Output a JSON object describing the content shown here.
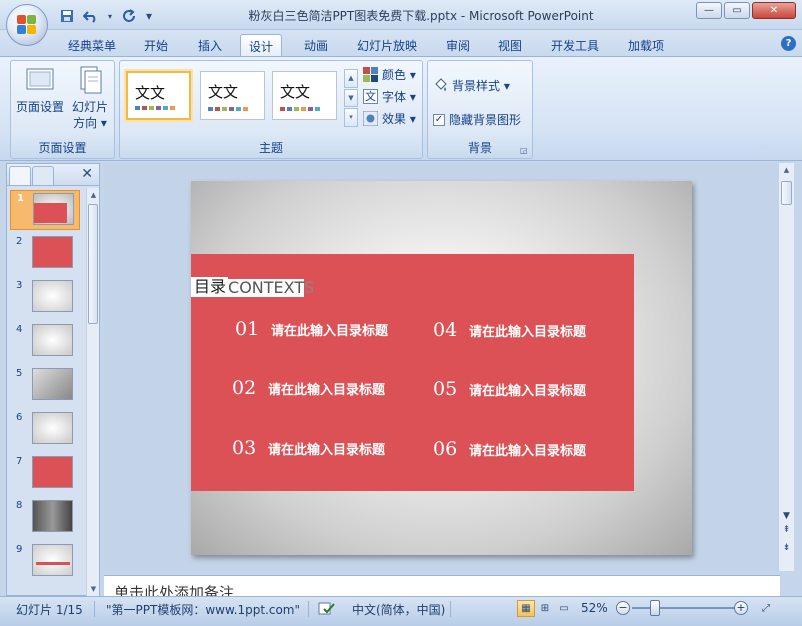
{
  "window": {
    "title": "粉灰白三色简洁PPT图表免费下载.pptx - Microsoft PowerPoint",
    "minimize": "—",
    "maximize": "▭",
    "close": "✕"
  },
  "qat": {
    "save_icon": "save-icon",
    "undo_icon": "undo-icon",
    "redo_icon": "redo-icon",
    "customize": "▾"
  },
  "tabs": [
    {
      "label": "经典菜单"
    },
    {
      "label": "开始"
    },
    {
      "label": "插入"
    },
    {
      "label": "设计",
      "active": true
    },
    {
      "label": "动画"
    },
    {
      "label": "幻灯片放映"
    },
    {
      "label": "审阅"
    },
    {
      "label": "视图"
    },
    {
      "label": "开发工具"
    },
    {
      "label": "加载项"
    }
  ],
  "ribbon": {
    "page_setup": {
      "label": "页面设置",
      "page_setup_btn": "页面设置",
      "orientation_btn_line1": "幻灯片",
      "orientation_btn_line2": "方向 ▾"
    },
    "themes": {
      "label": "主题",
      "thumb_text": "文文",
      "colors": "颜色 ▾",
      "fonts": "字体 ▾",
      "effects": "效果 ▾"
    },
    "background": {
      "label": "背景",
      "styles": "背景样式 ▾",
      "hide_graphics": "隐藏背景图形",
      "hide_graphics_checked": true
    }
  },
  "slides_pane": {
    "numbers": [
      "1",
      "2",
      "3",
      "4",
      "5",
      "6",
      "7",
      "8",
      "9"
    ],
    "selected": 1
  },
  "slide": {
    "heading_cn": "目录",
    "heading_en": "CONTEXT",
    "heading_en_tail": "S",
    "items": [
      {
        "num": "01",
        "text": "请在此输入目录标题"
      },
      {
        "num": "02",
        "text": "请在此输入目录标题"
      },
      {
        "num": "03",
        "text": "请在此输入目录标题"
      },
      {
        "num": "04",
        "text": "请在此输入目录标题"
      },
      {
        "num": "05",
        "text": "请在此输入目录标题"
      },
      {
        "num": "06",
        "text": "请在此输入目录标题"
      }
    ],
    "colors": {
      "red": "#dc5155"
    }
  },
  "notes": {
    "placeholder": "单击此处添加备注"
  },
  "statusbar": {
    "slide_index": "幻灯片 1/15",
    "theme": "\"第一PPT模板网：www.1ppt.com\"",
    "language": "中文(简体，中国)",
    "zoom": "52%"
  }
}
